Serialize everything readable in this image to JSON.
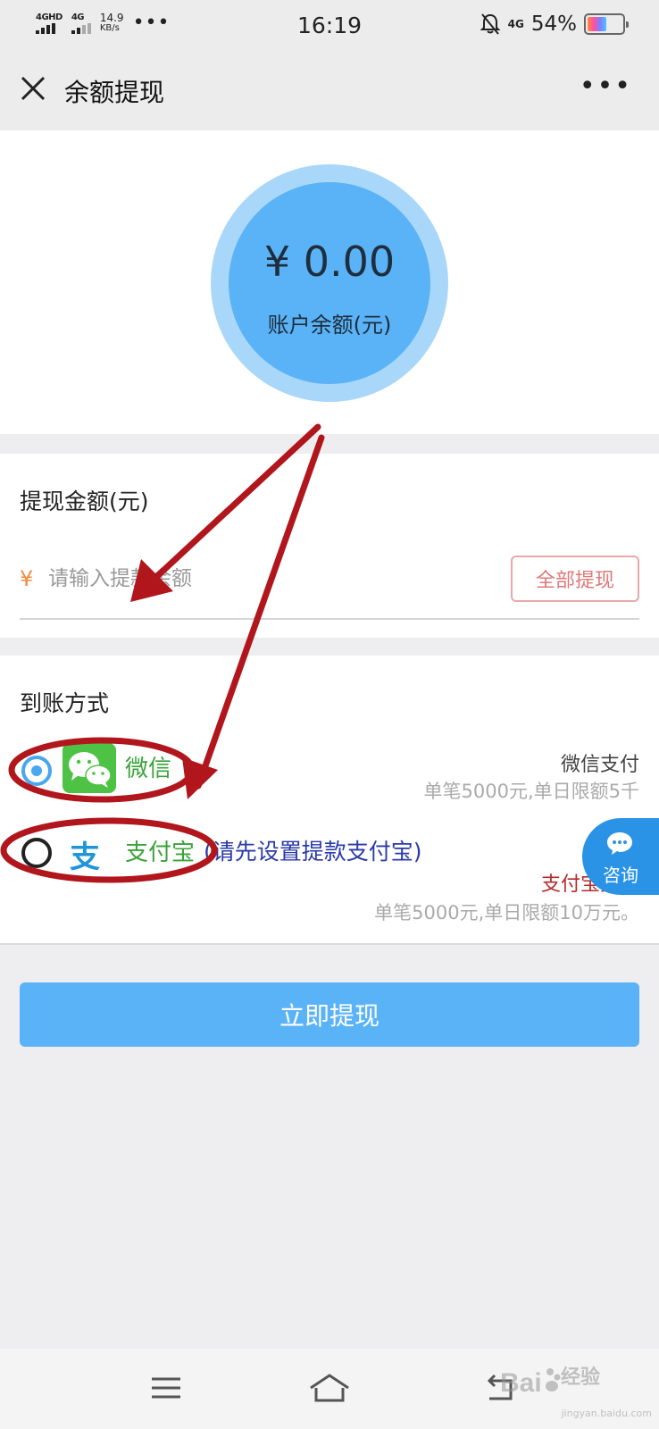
{
  "status_bar": {
    "signal1_label": "4GHD",
    "signal2_label": "4G",
    "speed_value": "14.9",
    "speed_unit": "KB/s",
    "dots": "•••",
    "time": "16:19",
    "network_right": "4G",
    "battery": "54%",
    "battery_level_percent": 54
  },
  "header": {
    "title": "余额提现",
    "more": "•••"
  },
  "balance": {
    "amount": "¥ 0.00",
    "label": "账户余额(元)"
  },
  "withdraw": {
    "title": "提现金额(元)",
    "currency_symbol": "¥",
    "input_placeholder": "请输入提款余额",
    "all_button": "全部提现"
  },
  "method": {
    "title": "到账方式",
    "options": [
      {
        "name": "微信",
        "right_title": "微信支付",
        "right_desc": "单笔5000元,单日限额5千",
        "selected": true
      },
      {
        "icon_glyph": "支",
        "name": "支付宝",
        "note": "(请先设置提款支付宝)",
        "right_title": "支付宝提现",
        "right_desc": "单笔5000元,单日限额10万元。",
        "selected": false
      }
    ]
  },
  "consult": {
    "label": "咨询"
  },
  "submit": {
    "label": "立即提现"
  },
  "watermark": {
    "brand": "Bai",
    "brand_suffix": "经验",
    "url": "jingyan.baidu.com"
  },
  "colors": {
    "accent_blue": "#5ab3f6",
    "wechat_green": "#4ec244",
    "alipay_blue": "#1e96d8",
    "annotation_red": "#b0161c"
  }
}
